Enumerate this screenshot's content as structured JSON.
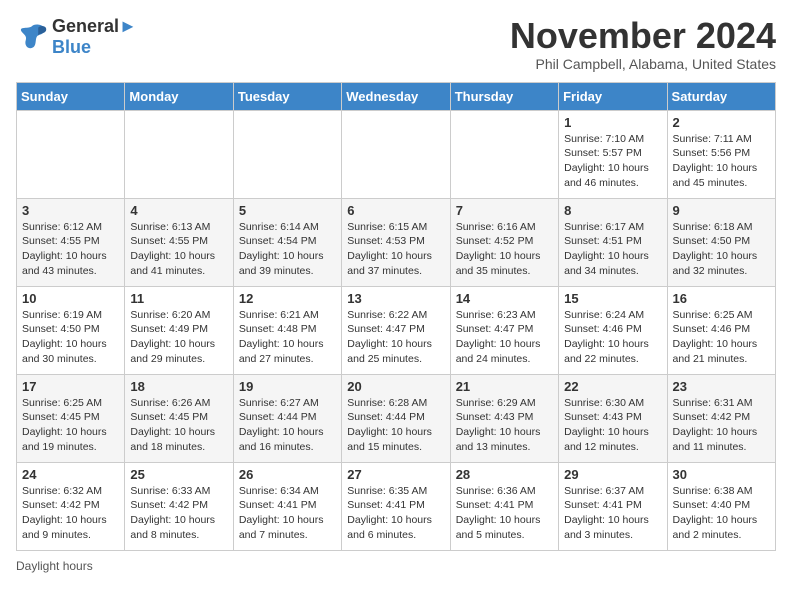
{
  "header": {
    "logo_line1": "General",
    "logo_line2": "Blue",
    "title": "November 2024",
    "subtitle": "Phil Campbell, Alabama, United States"
  },
  "days_of_week": [
    "Sunday",
    "Monday",
    "Tuesday",
    "Wednesday",
    "Thursday",
    "Friday",
    "Saturday"
  ],
  "weeks": [
    [
      {
        "day": "",
        "info": ""
      },
      {
        "day": "",
        "info": ""
      },
      {
        "day": "",
        "info": ""
      },
      {
        "day": "",
        "info": ""
      },
      {
        "day": "",
        "info": ""
      },
      {
        "day": "1",
        "info": "Sunrise: 7:10 AM\nSunset: 5:57 PM\nDaylight: 10 hours and 46 minutes."
      },
      {
        "day": "2",
        "info": "Sunrise: 7:11 AM\nSunset: 5:56 PM\nDaylight: 10 hours and 45 minutes."
      }
    ],
    [
      {
        "day": "3",
        "info": "Sunrise: 6:12 AM\nSunset: 4:55 PM\nDaylight: 10 hours and 43 minutes."
      },
      {
        "day": "4",
        "info": "Sunrise: 6:13 AM\nSunset: 4:55 PM\nDaylight: 10 hours and 41 minutes."
      },
      {
        "day": "5",
        "info": "Sunrise: 6:14 AM\nSunset: 4:54 PM\nDaylight: 10 hours and 39 minutes."
      },
      {
        "day": "6",
        "info": "Sunrise: 6:15 AM\nSunset: 4:53 PM\nDaylight: 10 hours and 37 minutes."
      },
      {
        "day": "7",
        "info": "Sunrise: 6:16 AM\nSunset: 4:52 PM\nDaylight: 10 hours and 35 minutes."
      },
      {
        "day": "8",
        "info": "Sunrise: 6:17 AM\nSunset: 4:51 PM\nDaylight: 10 hours and 34 minutes."
      },
      {
        "day": "9",
        "info": "Sunrise: 6:18 AM\nSunset: 4:50 PM\nDaylight: 10 hours and 32 minutes."
      }
    ],
    [
      {
        "day": "10",
        "info": "Sunrise: 6:19 AM\nSunset: 4:50 PM\nDaylight: 10 hours and 30 minutes."
      },
      {
        "day": "11",
        "info": "Sunrise: 6:20 AM\nSunset: 4:49 PM\nDaylight: 10 hours and 29 minutes."
      },
      {
        "day": "12",
        "info": "Sunrise: 6:21 AM\nSunset: 4:48 PM\nDaylight: 10 hours and 27 minutes."
      },
      {
        "day": "13",
        "info": "Sunrise: 6:22 AM\nSunset: 4:47 PM\nDaylight: 10 hours and 25 minutes."
      },
      {
        "day": "14",
        "info": "Sunrise: 6:23 AM\nSunset: 4:47 PM\nDaylight: 10 hours and 24 minutes."
      },
      {
        "day": "15",
        "info": "Sunrise: 6:24 AM\nSunset: 4:46 PM\nDaylight: 10 hours and 22 minutes."
      },
      {
        "day": "16",
        "info": "Sunrise: 6:25 AM\nSunset: 4:46 PM\nDaylight: 10 hours and 21 minutes."
      }
    ],
    [
      {
        "day": "17",
        "info": "Sunrise: 6:25 AM\nSunset: 4:45 PM\nDaylight: 10 hours and 19 minutes."
      },
      {
        "day": "18",
        "info": "Sunrise: 6:26 AM\nSunset: 4:45 PM\nDaylight: 10 hours and 18 minutes."
      },
      {
        "day": "19",
        "info": "Sunrise: 6:27 AM\nSunset: 4:44 PM\nDaylight: 10 hours and 16 minutes."
      },
      {
        "day": "20",
        "info": "Sunrise: 6:28 AM\nSunset: 4:44 PM\nDaylight: 10 hours and 15 minutes."
      },
      {
        "day": "21",
        "info": "Sunrise: 6:29 AM\nSunset: 4:43 PM\nDaylight: 10 hours and 13 minutes."
      },
      {
        "day": "22",
        "info": "Sunrise: 6:30 AM\nSunset: 4:43 PM\nDaylight: 10 hours and 12 minutes."
      },
      {
        "day": "23",
        "info": "Sunrise: 6:31 AM\nSunset: 4:42 PM\nDaylight: 10 hours and 11 minutes."
      }
    ],
    [
      {
        "day": "24",
        "info": "Sunrise: 6:32 AM\nSunset: 4:42 PM\nDaylight: 10 hours and 9 minutes."
      },
      {
        "day": "25",
        "info": "Sunrise: 6:33 AM\nSunset: 4:42 PM\nDaylight: 10 hours and 8 minutes."
      },
      {
        "day": "26",
        "info": "Sunrise: 6:34 AM\nSunset: 4:41 PM\nDaylight: 10 hours and 7 minutes."
      },
      {
        "day": "27",
        "info": "Sunrise: 6:35 AM\nSunset: 4:41 PM\nDaylight: 10 hours and 6 minutes."
      },
      {
        "day": "28",
        "info": "Sunrise: 6:36 AM\nSunset: 4:41 PM\nDaylight: 10 hours and 5 minutes."
      },
      {
        "day": "29",
        "info": "Sunrise: 6:37 AM\nSunset: 4:41 PM\nDaylight: 10 hours and 3 minutes."
      },
      {
        "day": "30",
        "info": "Sunrise: 6:38 AM\nSunset: 4:40 PM\nDaylight: 10 hours and 2 minutes."
      }
    ]
  ],
  "footer": {
    "note": "Daylight hours"
  }
}
